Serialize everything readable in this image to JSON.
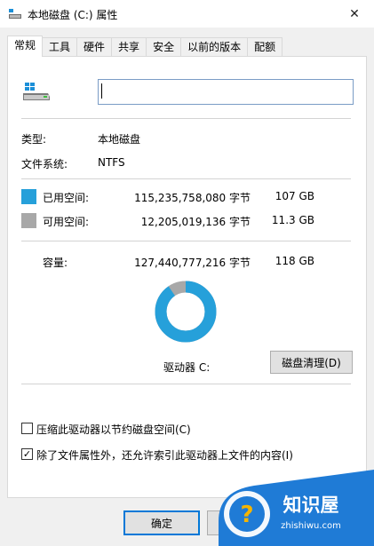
{
  "window": {
    "title": "本地磁盘 (C:) 属性",
    "close_glyph": "✕",
    "icon": "drive-icon"
  },
  "tabs": [
    {
      "label": "常规",
      "active": true
    },
    {
      "label": "工具"
    },
    {
      "label": "硬件"
    },
    {
      "label": "共享"
    },
    {
      "label": "安全"
    },
    {
      "label": "以前的版本"
    },
    {
      "label": "配额"
    }
  ],
  "general": {
    "name_value": "",
    "type_label": "类型:",
    "type_value": "本地磁盘",
    "fs_label": "文件系统:",
    "fs_value": "NTFS",
    "used": {
      "label": "已用空间:",
      "bytes": "115,235,758,080 字节",
      "size": "107 GB",
      "color": "#26a0da"
    },
    "free": {
      "label": "可用空间:",
      "bytes": "12,205,019,136 字节",
      "size": "11.3 GB",
      "color": "#a8a8a8"
    },
    "capacity": {
      "label": "容量:",
      "bytes": "127,440,777,216 字节",
      "size": "118 GB"
    },
    "used_fraction": 0.904,
    "drive_label": "驱动器 C:",
    "cleanup_button": "磁盘清理(D)",
    "compress_label": "压缩此驱动器以节约磁盘空间(C)",
    "compress_checked": false,
    "index_label": "除了文件属性外，还允许索引此驱动器上文件的内容(I)",
    "index_checked": true,
    "check_glyph": "✓"
  },
  "footer": {
    "ok_label": "确定"
  },
  "watermark": {
    "brand": "知识屋",
    "url": "zhishiwu.com",
    "glyph": "?"
  }
}
